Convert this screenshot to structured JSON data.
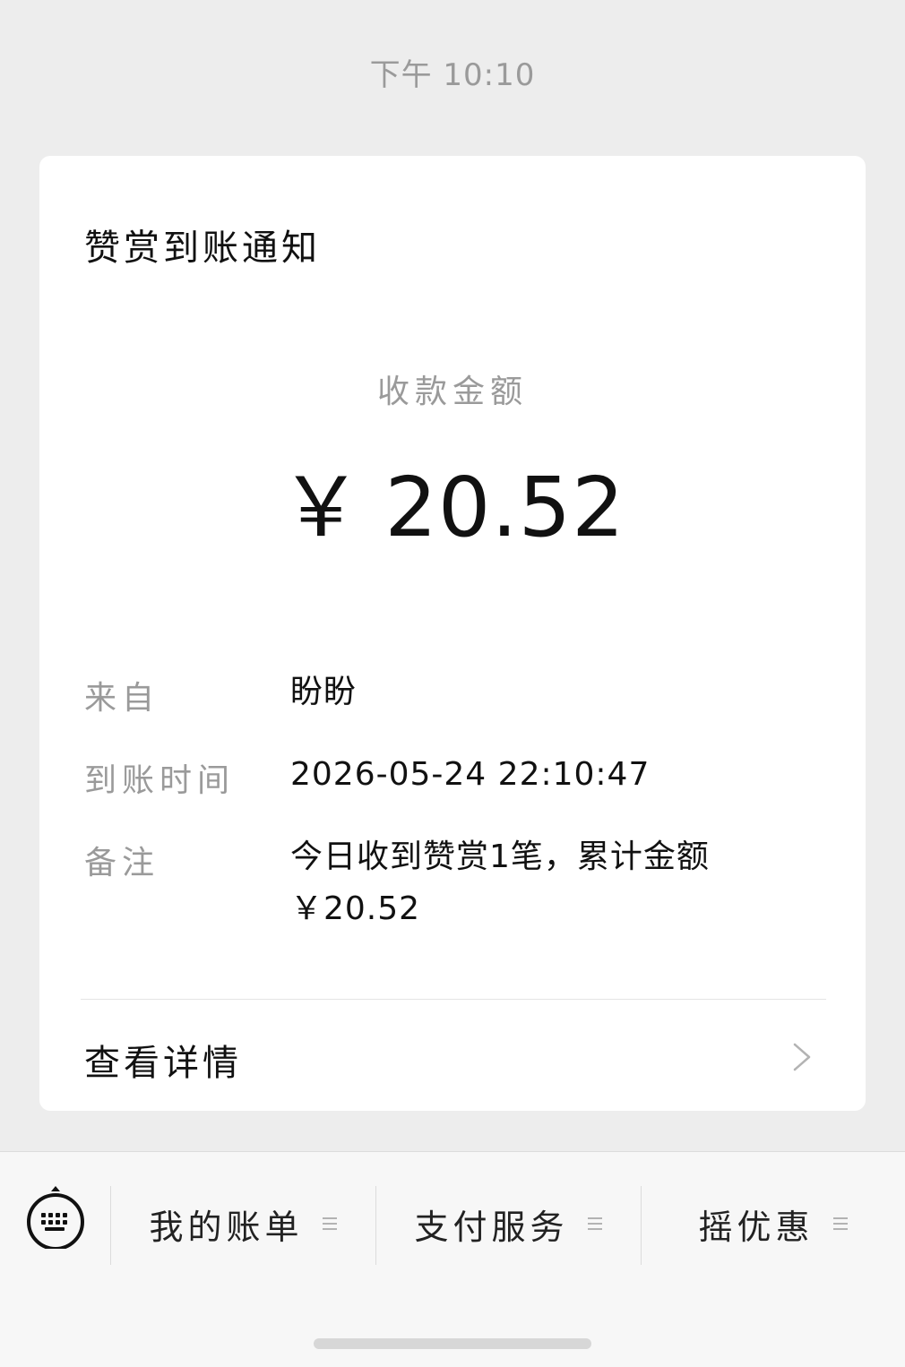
{
  "message_time": "下午 10:10",
  "card": {
    "title": "赞赏到账通知",
    "amount_label": "收款金额",
    "currency_symbol": "￥",
    "amount": "20.52",
    "rows": [
      {
        "label": "来自",
        "value": "盼盼"
      },
      {
        "label": "到账时间",
        "value": "2026-05-24 22:10:47"
      },
      {
        "label": "备注",
        "value_line1": "今日收到赞赏1笔，累计金额",
        "value_line2": "￥20.52"
      }
    ],
    "detail_link": "查看详情",
    "detail_icon": "chevron-right-icon"
  },
  "bottom_menu": {
    "keyboard_icon": "keyboard-icon",
    "items": [
      {
        "label": "我的账单",
        "icon": "menu-lines-icon"
      },
      {
        "label": "支付服务",
        "icon": "menu-lines-icon"
      },
      {
        "label": "摇优惠",
        "icon": "menu-lines-icon"
      }
    ]
  },
  "colors": {
    "background": "#ededed",
    "card": "#ffffff",
    "muted_text": "#9a9a9a",
    "primary_text": "#111111"
  }
}
